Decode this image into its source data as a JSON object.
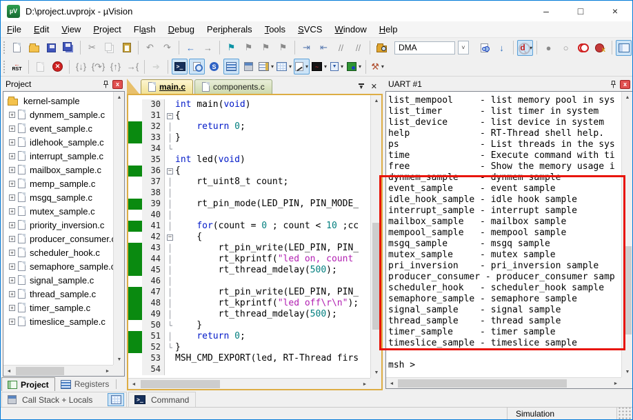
{
  "window": {
    "title": "D:\\project.uvprojx - µVision",
    "logo_text": "µV",
    "controls": {
      "minimize": "–",
      "maximize": "□",
      "close": "×"
    }
  },
  "menu": {
    "items": [
      {
        "label": "File",
        "hotkey": 0
      },
      {
        "label": "Edit",
        "hotkey": 0
      },
      {
        "label": "View",
        "hotkey": 0
      },
      {
        "label": "Project",
        "hotkey": 0
      },
      {
        "label": "Flash",
        "hotkey": 2
      },
      {
        "label": "Debug",
        "hotkey": 0
      },
      {
        "label": "Peripherals",
        "hotkey": 3
      },
      {
        "label": "Tools",
        "hotkey": 0
      },
      {
        "label": "SVCS",
        "hotkey": 0
      },
      {
        "label": "Window",
        "hotkey": 0
      },
      {
        "label": "Help",
        "hotkey": 0
      }
    ]
  },
  "toolbar1": {
    "combo_value": "DMA",
    "items": [
      {
        "name": "new-file",
        "shape": "doc"
      },
      {
        "name": "open-file",
        "shape": "folder"
      },
      {
        "name": "save",
        "shape": "disk"
      },
      {
        "name": "save-all",
        "shape": "disk2"
      },
      {
        "sep": 1
      },
      {
        "name": "cut",
        "glyph": "✂",
        "dis": 1
      },
      {
        "name": "copy",
        "shape": "copy",
        "dis": 1
      },
      {
        "name": "paste",
        "shape": "paste"
      },
      {
        "sep": 1
      },
      {
        "name": "undo",
        "glyph": "↶",
        "dis": 1
      },
      {
        "name": "redo",
        "glyph": "↷",
        "dis": 1
      },
      {
        "sep": 1
      },
      {
        "name": "navigate-back",
        "glyph": "←",
        "color": "#3b76c8"
      },
      {
        "name": "navigate-forward",
        "glyph": "→",
        "dis": 1
      },
      {
        "sep": 1
      },
      {
        "name": "insert-bookmark",
        "glyph": "⚑",
        "color": "#0d93a5"
      },
      {
        "name": "next-bookmark",
        "glyph": "⚑",
        "dis": 1
      },
      {
        "name": "prev-bookmark",
        "glyph": "⚑",
        "dis": 1
      },
      {
        "name": "clear-bookmarks",
        "glyph": "⚑",
        "dis": 1
      },
      {
        "sep": 1
      },
      {
        "name": "indent",
        "glyph": "⇥",
        "color": "#5a7ab0"
      },
      {
        "name": "outdent",
        "glyph": "⇤",
        "color": "#5a7ab0"
      },
      {
        "name": "comment",
        "glyph": "//",
        "dis": 1
      },
      {
        "name": "uncomment",
        "glyph": "//",
        "dis": 1
      },
      {
        "sep": 1
      },
      {
        "name": "find-in-files",
        "shape": "folderfind"
      },
      {
        "combo": 1
      },
      {
        "name": "find-in-files-dialog",
        "shape": "docfind"
      },
      {
        "name": "incremental-find",
        "glyph": "↓",
        "color": "#2f6fbe"
      },
      {
        "sep": 1
      },
      {
        "name": "quick-find",
        "shape": "dmag",
        "hl": 1,
        "dd": 1
      },
      {
        "sep": 1
      },
      {
        "name": "insert-remove-breakpoint",
        "glyph": "●",
        "dis": 1
      },
      {
        "name": "enable-disable-breakpoint",
        "glyph": "○",
        "dis": 1
      },
      {
        "name": "disable-all-breakpoints",
        "shape": "bp2"
      },
      {
        "name": "kill-all-breakpoints",
        "shape": "bpx"
      },
      {
        "sep": 1
      },
      {
        "name": "window-layout",
        "shape": "winicon",
        "hl": 1
      }
    ]
  },
  "toolbar2": {
    "items": [
      {
        "name": "reset-cpu",
        "shape": "rst"
      },
      {
        "sep": 1
      },
      {
        "name": "run",
        "shape": "rundoc",
        "dis": 1
      },
      {
        "name": "stop",
        "shape": "stop"
      },
      {
        "sep": 1
      },
      {
        "name": "step-into",
        "glyph": "{↓}",
        "dis": 1
      },
      {
        "name": "step-over",
        "glyph": "{↷}",
        "dis": 1
      },
      {
        "name": "step-out",
        "glyph": "{↑}",
        "dis": 1
      },
      {
        "name": "run-to-cursor",
        "glyph": "→{",
        "dis": 1
      },
      {
        "sep": 1
      },
      {
        "name": "go-next",
        "glyph": "➔",
        "color": "#94ae94",
        "dis": 1
      },
      {
        "sep": 1
      },
      {
        "name": "command-window",
        "shape": "term",
        "hl": 1
      },
      {
        "name": "disassembly-window",
        "shape": "disasm",
        "hl": 1
      },
      {
        "name": "symbol-window",
        "shape": "symbol"
      },
      {
        "name": "registers-window",
        "shape": "regs",
        "hl": 1
      },
      {
        "name": "call-stack-window",
        "shape": "callstack"
      },
      {
        "name": "watch-window",
        "shape": "watch",
        "dd": 1
      },
      {
        "name": "memory-window",
        "shape": "memory",
        "dd": 1
      },
      {
        "name": "serial-window",
        "shape": "serial",
        "hl": 1,
        "dd": 1
      },
      {
        "name": "analysis-window",
        "shape": "logic",
        "dd": 1
      },
      {
        "name": "trace-window",
        "shape": "sysview",
        "dd": 1
      },
      {
        "name": "system-viewer",
        "shape": "chip",
        "dd": 1
      },
      {
        "sep": 1
      },
      {
        "name": "toolbox",
        "glyph": "⚒",
        "color": "#b05030",
        "dd": 1
      }
    ]
  },
  "project_panel": {
    "title": "Project",
    "root": "kernel-sample",
    "files": [
      "dynmem_sample.c",
      "event_sample.c",
      "idlehook_sample.c",
      "interrupt_sample.c",
      "mailbox_sample.c",
      "memp_sample.c",
      "msgq_sample.c",
      "mutex_sample.c",
      "priority_inversion.c",
      "producer_consumer.c",
      "scheduler_hook.c",
      "semaphore_sample.c",
      "signal_sample.c",
      "thread_sample.c",
      "timer_sample.c",
      "timeslice_sample.c"
    ],
    "tabs": [
      {
        "label": "Project",
        "active": 1,
        "icon": "projtab"
      },
      {
        "label": "Registers",
        "active": 0,
        "icon": "regs"
      }
    ]
  },
  "editor": {
    "tabs": [
      {
        "label": "main.c",
        "active": 1
      },
      {
        "label": "components.c",
        "active": 0
      }
    ],
    "lines": [
      {
        "n": 30,
        "f": "",
        "g": 0,
        "s": [
          [
            "k",
            "int"
          ],
          [
            "t",
            " main("
          ],
          [
            "k",
            "void"
          ],
          [
            "t",
            ")"
          ]
        ]
      },
      {
        "n": 31,
        "f": "b",
        "g": 0,
        "s": [
          [
            "t",
            "{"
          ]
        ]
      },
      {
        "n": 32,
        "f": "v",
        "g": 1,
        "s": [
          [
            "t",
            "    "
          ],
          [
            "k",
            "return"
          ],
          [
            "t",
            " "
          ],
          [
            "m",
            "0"
          ],
          [
            "t",
            ";"
          ]
        ]
      },
      {
        "n": 33,
        "f": "v",
        "g": 1,
        "s": [
          [
            "t",
            "}"
          ]
        ]
      },
      {
        "n": 34,
        "f": "e",
        "g": 0,
        "s": []
      },
      {
        "n": 35,
        "f": "",
        "g": 0,
        "s": [
          [
            "k",
            "int"
          ],
          [
            "t",
            " led("
          ],
          [
            "k",
            "void"
          ],
          [
            "t",
            ")"
          ]
        ]
      },
      {
        "n": 36,
        "f": "b",
        "g": 1,
        "s": [
          [
            "t",
            "{"
          ]
        ]
      },
      {
        "n": 37,
        "f": "v",
        "g": 0,
        "s": [
          [
            "t",
            "    rt_uint8_t count;"
          ]
        ]
      },
      {
        "n": 38,
        "f": "v",
        "g": 0,
        "s": []
      },
      {
        "n": 39,
        "f": "v",
        "g": 1,
        "s": [
          [
            "t",
            "    rt_pin_mode(LED_PIN, PIN_MODE_"
          ]
        ]
      },
      {
        "n": 40,
        "f": "v",
        "g": 0,
        "s": []
      },
      {
        "n": 41,
        "f": "v",
        "g": 1,
        "s": [
          [
            "t",
            "    "
          ],
          [
            "k",
            "for"
          ],
          [
            "t",
            "(count = "
          ],
          [
            "m",
            "0"
          ],
          [
            "t",
            " ; count < "
          ],
          [
            "m",
            "10"
          ],
          [
            "t",
            " ;cc"
          ]
        ]
      },
      {
        "n": 42,
        "f": "b",
        "g": 0,
        "s": [
          [
            "t",
            "    {"
          ]
        ]
      },
      {
        "n": 43,
        "f": "v",
        "g": 1,
        "s": [
          [
            "t",
            "        rt_pin_write(LED_PIN, PIN_"
          ]
        ]
      },
      {
        "n": 44,
        "f": "v",
        "g": 1,
        "s": [
          [
            "t",
            "        rt_kprintf("
          ],
          [
            "x",
            "\"led on, count"
          ]
        ]
      },
      {
        "n": 45,
        "f": "v",
        "g": 1,
        "s": [
          [
            "t",
            "        rt_thread_mdelay("
          ],
          [
            "m",
            "500"
          ],
          [
            "t",
            ");"
          ]
        ]
      },
      {
        "n": 46,
        "f": "v",
        "g": 0,
        "s": []
      },
      {
        "n": 47,
        "f": "v",
        "g": 1,
        "s": [
          [
            "t",
            "        rt_pin_write(LED_PIN, PIN_"
          ]
        ]
      },
      {
        "n": 48,
        "f": "v",
        "g": 1,
        "s": [
          [
            "t",
            "        rt_kprintf("
          ],
          [
            "x",
            "\"led off\\r\\n\""
          ],
          [
            "t",
            ");"
          ]
        ]
      },
      {
        "n": 49,
        "f": "v",
        "g": 1,
        "s": [
          [
            "t",
            "        rt_thread_mdelay("
          ],
          [
            "m",
            "500"
          ],
          [
            "t",
            ");"
          ]
        ]
      },
      {
        "n": 50,
        "f": "e",
        "g": 0,
        "s": [
          [
            "t",
            "    }"
          ]
        ]
      },
      {
        "n": 51,
        "f": "v",
        "g": 1,
        "s": [
          [
            "t",
            "    "
          ],
          [
            "k",
            "return"
          ],
          [
            "t",
            " "
          ],
          [
            "m",
            "0"
          ],
          [
            "t",
            ";"
          ]
        ]
      },
      {
        "n": 52,
        "f": "e",
        "g": 1,
        "s": [
          [
            "t",
            "}"
          ]
        ]
      },
      {
        "n": 53,
        "f": "",
        "g": 0,
        "s": [
          [
            "t",
            "MSH_CMD_EXPORT(led, RT-Thread firs"
          ]
        ]
      },
      {
        "n": 54,
        "f": "",
        "g": 0,
        "s": []
      }
    ]
  },
  "uart_panel": {
    "title": "UART #1",
    "lines": [
      "list_mempool     - list memory pool in sys",
      "list_timer       - list timer in system",
      "list_device      - list device in system",
      "help             - RT-Thread shell help.",
      "ps               - List threads in the sys",
      "time             - Execute command with ti",
      "free             - Show the memory usage i",
      "dynmem_sample    - dynmem sample",
      "event_sample     - event sample",
      "idle_hook_sample - idle hook sample",
      "interrupt_sample - interrupt sample",
      "mailbox_sample   - mailbox sample",
      "mempool_sample   - mempool sample",
      "msgq_sample      - msgq sample",
      "mutex_sample     - mutex sample",
      "pri_inversion    - pri_inversion sample",
      "producer_consumer - producer_consumer samp",
      "scheduler_hook   - scheduler_hook sample",
      "semaphore_sample - semaphore sample",
      "signal_sample    - signal sample",
      "thread_sample    - thread sample",
      "timer_sample     - timer sample",
      "timeslice_sample - timeslice sample",
      "",
      "msh >"
    ]
  },
  "bottom": {
    "call_stack_label": "Call Stack + Locals",
    "command_label": "Command"
  },
  "status": {
    "mode": "Simulation"
  },
  "colors": {
    "annotation": "#e81408",
    "change_bar": "#0a8a10",
    "keyword": "#0018c8",
    "number": "#007e7e",
    "string": "#b11fb1"
  }
}
